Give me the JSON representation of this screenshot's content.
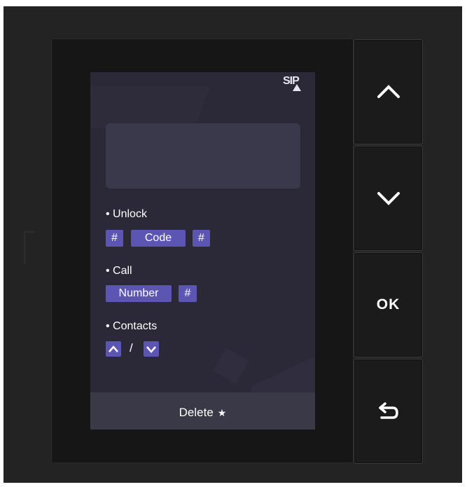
{
  "status": {
    "icon": "sip-alert-icon",
    "text": "SIP"
  },
  "sections": {
    "unlock": {
      "label": "• Unlock",
      "chips": [
        "#",
        "Code",
        "#"
      ]
    },
    "call": {
      "label": "• Call",
      "chips": [
        "Number",
        "#"
      ]
    },
    "contacts": {
      "label": "• Contacts",
      "separator": "/",
      "icons": [
        "chevron-up-icon",
        "chevron-down-icon"
      ]
    }
  },
  "footer": {
    "label": "Delete",
    "star": "★"
  },
  "buttons": {
    "up": "chevron-up-icon",
    "down": "chevron-down-icon",
    "ok": "OK",
    "back": "back-arrow-icon"
  },
  "colors": {
    "screen_bg": "#2b2938",
    "chip": "#5c55b4",
    "device": "#232323"
  }
}
